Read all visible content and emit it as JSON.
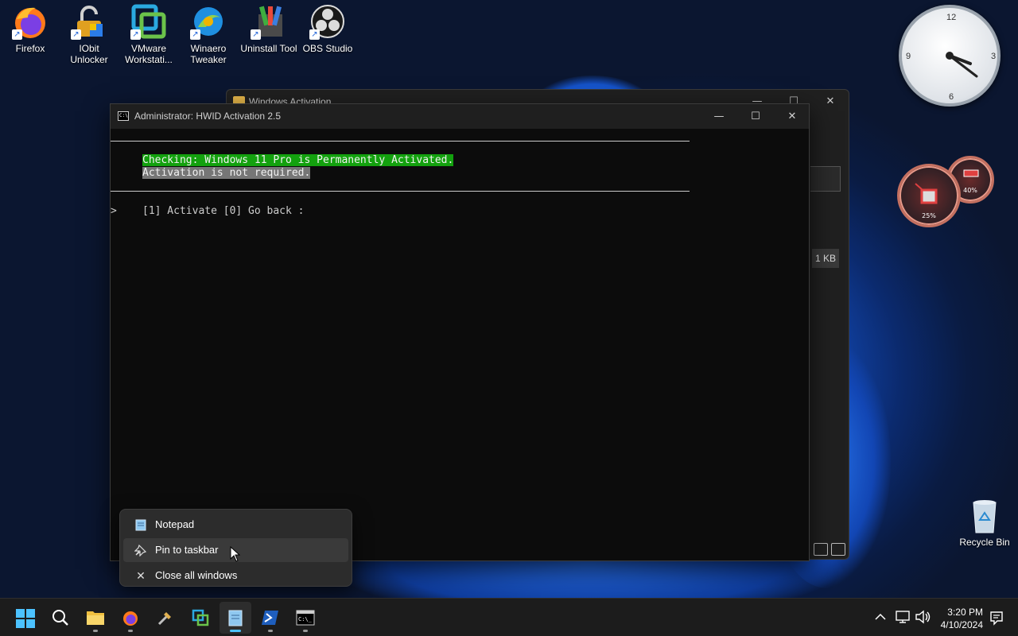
{
  "desktop": {
    "icons": [
      {
        "label": "Firefox"
      },
      {
        "label": "IObit\nUnlocker"
      },
      {
        "label": "VMware\nWorkstati..."
      },
      {
        "label": "Winaero\nTweaker"
      },
      {
        "label": "Uninstall Tool"
      },
      {
        "label": "OBS Studio"
      }
    ],
    "recycle_bin": "Recycle Bin"
  },
  "gadgets": {
    "clock_numbers": [
      "12",
      "3",
      "6",
      "9"
    ],
    "cpu_percent": "25%",
    "memory_percent": "40%"
  },
  "explorer": {
    "title": "Windows Activation",
    "file_size": "1 KB"
  },
  "console": {
    "title": "Administrator:  HWID Activation 2.5",
    "status_line": "Checking: Windows 11 Pro is Permanently Activated.",
    "status_line2": "Activation is not required.",
    "prompt_marker": ">",
    "menu_line": "[1] Activate [0] Go back :"
  },
  "jumplist": {
    "items": [
      {
        "label": "Notepad"
      },
      {
        "label": "Pin to taskbar"
      },
      {
        "label": "Close all windows"
      }
    ]
  },
  "taskbar": {
    "time": "3:20 PM",
    "date": "4/10/2024"
  },
  "colors": {
    "console_green": "#13a10e",
    "console_gray": "#767676",
    "accent": "#4cc2ff"
  }
}
